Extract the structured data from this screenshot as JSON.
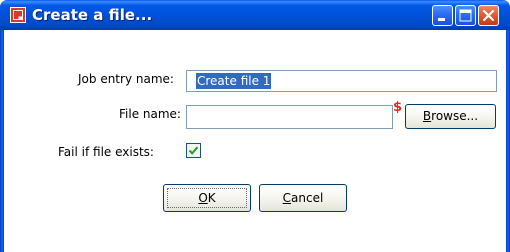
{
  "window": {
    "title": "Create a file...",
    "icon": "app-icon",
    "controls": {
      "minimize_icon": "minimize-icon",
      "maximize_icon": "maximize-icon",
      "close_icon": "close-icon"
    }
  },
  "form": {
    "job_entry": {
      "label": "Job entry name:",
      "value": "Create file 1"
    },
    "file_name": {
      "label": "File name:",
      "value": "",
      "variable_marker": "$"
    },
    "browse": {
      "prefix": "B",
      "suffix": "rowse..."
    },
    "fail_if_exists": {
      "label": "Fail if file exists:",
      "checked": true
    }
  },
  "buttons": {
    "ok": {
      "accel": "O",
      "rest": "K"
    },
    "cancel": {
      "accel": "C",
      "rest": "ancel"
    }
  },
  "colors": {
    "titlebar": "#0052da",
    "close_button": "#e25c34",
    "selection": "#316ac5",
    "variable_marker": "#e0281e",
    "checkmark": "#21a121"
  }
}
